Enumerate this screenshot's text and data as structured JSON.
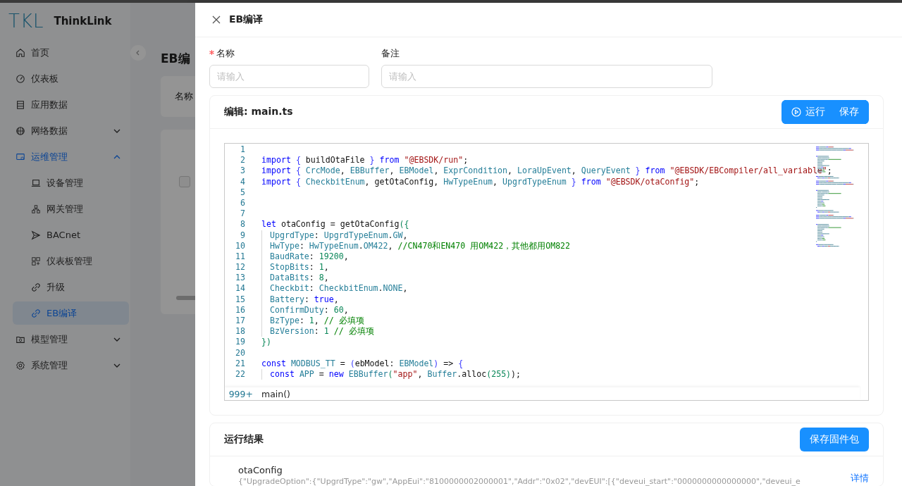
{
  "brand": {
    "logo": "TKL",
    "name": "ThinkLink"
  },
  "sidebar": {
    "items": [
      {
        "label": "首页",
        "selected": false
      },
      {
        "label": "仪表板",
        "selected": false
      },
      {
        "label": "应用数据",
        "selected": false
      },
      {
        "label": "网络数据",
        "selected": false,
        "expanded": false
      },
      {
        "label": "运维管理",
        "selected": false,
        "expanded": true,
        "children": [
          {
            "label": "设备管理",
            "selected": false
          },
          {
            "label": "网关管理",
            "selected": false
          },
          {
            "label": "BACnet",
            "selected": false
          },
          {
            "label": "仪表板管理",
            "selected": false
          },
          {
            "label": "升级",
            "selected": false
          },
          {
            "label": "EB编译",
            "selected": true
          }
        ]
      },
      {
        "label": "模型管理",
        "selected": false,
        "expanded": false
      },
      {
        "label": "系统管理",
        "selected": false,
        "expanded": false
      }
    ]
  },
  "background_page": {
    "title": "EB编",
    "filter_label": "名称",
    "table_checkbox": {
      "checked": false
    }
  },
  "drawer": {
    "title": "EB编译",
    "form": [
      {
        "label": "名称",
        "required": true,
        "placeholder": "请输入"
      },
      {
        "label": "备注",
        "required": false,
        "placeholder": "请输入"
      }
    ],
    "editor": {
      "title": "编辑: main.ts",
      "buttons": [
        {
          "label": "运行",
          "kind": "run"
        },
        {
          "label": "保存",
          "kind": "plain"
        }
      ],
      "lines": [
        {
          "number": "1"
        },
        {
          "number": "2",
          "indented": false,
          "tokens": [
            {
              "kind": "kw",
              "text": "import "
            },
            {
              "kind": "brace",
              "text": "{ "
            },
            {
              "kind": "plain",
              "text": "buildOtaFile "
            },
            {
              "kind": "brace",
              "text": "} "
            },
            {
              "kind": "kw",
              "text": "from "
            },
            {
              "kind": "str",
              "text": "\"@EBSDK/run\""
            },
            {
              "kind": "plain",
              "text": ";"
            }
          ]
        },
        {
          "number": "3",
          "indented": false,
          "tokens": [
            {
              "kind": "kw",
              "text": "import "
            },
            {
              "kind": "brace",
              "text": "{ "
            },
            {
              "kind": "type",
              "text": "CrcMode"
            },
            {
              "kind": "plain",
              "text": ", "
            },
            {
              "kind": "type",
              "text": "EBBuffer"
            },
            {
              "kind": "plain",
              "text": ", "
            },
            {
              "kind": "type",
              "text": "EBModel"
            },
            {
              "kind": "plain",
              "text": ", "
            },
            {
              "kind": "type",
              "text": "ExprCondition"
            },
            {
              "kind": "plain",
              "text": ", "
            },
            {
              "kind": "type",
              "text": "LoraUpEvent"
            },
            {
              "kind": "plain",
              "text": ", "
            },
            {
              "kind": "type",
              "text": "QueryEvent "
            },
            {
              "kind": "brace",
              "text": "} "
            },
            {
              "kind": "kw",
              "text": "from "
            },
            {
              "kind": "str",
              "text": "\"@EBSDK/EBCompiler/all_variable\""
            },
            {
              "kind": "plain",
              "text": ";"
            }
          ]
        },
        {
          "number": "4",
          "indented": false,
          "tokens": [
            {
              "kind": "kw",
              "text": "import "
            },
            {
              "kind": "brace",
              "text": "{ "
            },
            {
              "kind": "type",
              "text": "CheckbitEnum"
            },
            {
              "kind": "plain",
              "text": ", getOtaConfig, "
            },
            {
              "kind": "type",
              "text": "HwTypeEnum"
            },
            {
              "kind": "plain",
              "text": ", "
            },
            {
              "kind": "type",
              "text": "UpgrdTypeEnum "
            },
            {
              "kind": "brace",
              "text": "} "
            },
            {
              "kind": "kw",
              "text": "from "
            },
            {
              "kind": "str",
              "text": "\"@EBSDK/otaConfig\""
            },
            {
              "kind": "plain",
              "text": ";"
            }
          ]
        },
        {
          "number": "5"
        },
        {
          "number": "6"
        },
        {
          "number": "7"
        },
        {
          "number": "8",
          "indented": false,
          "tokens": [
            {
              "kind": "kw",
              "text": "let "
            },
            {
              "kind": "plain",
              "text": "otaConfig = getOtaConfig"
            },
            {
              "kind": "num",
              "text": "({"
            }
          ]
        },
        {
          "number": "9",
          "indented": true,
          "tokens": [
            {
              "kind": "prop",
              "text": "UpgrdType"
            },
            {
              "kind": "plain",
              "text": ": "
            },
            {
              "kind": "type",
              "text": "UpgrdTypeEnum"
            },
            {
              "kind": "plain",
              "text": "."
            },
            {
              "kind": "type",
              "text": "GW"
            },
            {
              "kind": "plain",
              "text": ","
            }
          ]
        },
        {
          "number": "10",
          "indented": true,
          "tokens": [
            {
              "kind": "prop",
              "text": "HwType"
            },
            {
              "kind": "plain",
              "text": ": "
            },
            {
              "kind": "type",
              "text": "HwTypeEnum"
            },
            {
              "kind": "plain",
              "text": "."
            },
            {
              "kind": "type",
              "text": "OM422"
            },
            {
              "kind": "plain",
              "text": ", "
            },
            {
              "kind": "com",
              "text": "//CN470和EN470 用OM422，其他都用OM822"
            }
          ]
        },
        {
          "number": "11",
          "indented": true,
          "tokens": [
            {
              "kind": "prop",
              "text": "BaudRate"
            },
            {
              "kind": "plain",
              "text": ": "
            },
            {
              "kind": "num",
              "text": "19200"
            },
            {
              "kind": "plain",
              "text": ","
            }
          ]
        },
        {
          "number": "12",
          "indented": true,
          "tokens": [
            {
              "kind": "prop",
              "text": "StopBits"
            },
            {
              "kind": "plain",
              "text": ": "
            },
            {
              "kind": "num",
              "text": "1"
            },
            {
              "kind": "plain",
              "text": ","
            }
          ]
        },
        {
          "number": "13",
          "indented": true,
          "tokens": [
            {
              "kind": "prop",
              "text": "DataBits"
            },
            {
              "kind": "plain",
              "text": ": "
            },
            {
              "kind": "num",
              "text": "8"
            },
            {
              "kind": "plain",
              "text": ","
            }
          ]
        },
        {
          "number": "14",
          "indented": true,
          "tokens": [
            {
              "kind": "prop",
              "text": "Checkbit"
            },
            {
              "kind": "plain",
              "text": ": "
            },
            {
              "kind": "type",
              "text": "CheckbitEnum"
            },
            {
              "kind": "plain",
              "text": "."
            },
            {
              "kind": "type",
              "text": "NONE"
            },
            {
              "kind": "plain",
              "text": ","
            }
          ]
        },
        {
          "number": "15",
          "indented": true,
          "tokens": [
            {
              "kind": "prop",
              "text": "Battery"
            },
            {
              "kind": "plain",
              "text": ": "
            },
            {
              "kind": "kw",
              "text": "true"
            },
            {
              "kind": "plain",
              "text": ","
            }
          ]
        },
        {
          "number": "16",
          "indented": true,
          "tokens": [
            {
              "kind": "prop",
              "text": "ConfirmDuty"
            },
            {
              "kind": "plain",
              "text": ": "
            },
            {
              "kind": "num",
              "text": "60"
            },
            {
              "kind": "plain",
              "text": ","
            }
          ]
        },
        {
          "number": "17",
          "indented": true,
          "tokens": [
            {
              "kind": "prop",
              "text": "BzType"
            },
            {
              "kind": "plain",
              "text": ": "
            },
            {
              "kind": "num",
              "text": "1"
            },
            {
              "kind": "plain",
              "text": ", "
            },
            {
              "kind": "com",
              "text": "// 必填项"
            }
          ]
        },
        {
          "number": "18",
          "indented": true,
          "tokens": [
            {
              "kind": "prop",
              "text": "BzVersion"
            },
            {
              "kind": "plain",
              "text": ": "
            },
            {
              "kind": "num",
              "text": "1 "
            },
            {
              "kind": "com",
              "text": "// 必填项"
            }
          ]
        },
        {
          "number": "19",
          "indented": false,
          "tokens": [
            {
              "kind": "num",
              "text": "})"
            }
          ]
        },
        {
          "number": "20"
        },
        {
          "number": "21",
          "indented": false,
          "tokens": [
            {
              "kind": "kw",
              "text": "const "
            },
            {
              "kind": "type",
              "text": "MODBUS_TT"
            },
            {
              "kind": "plain",
              "text": " = "
            },
            {
              "kind": "brace",
              "text": "("
            },
            {
              "kind": "plain",
              "text": "ebModel: "
            },
            {
              "kind": "type",
              "text": "EBModel"
            },
            {
              "kind": "brace",
              "text": ") "
            },
            {
              "kind": "plain",
              "text": "=> "
            },
            {
              "kind": "brace",
              "text": "{"
            }
          ]
        },
        {
          "number": "22",
          "indented": true,
          "tokens": [
            {
              "kind": "kw",
              "text": "const "
            },
            {
              "kind": "type",
              "text": "APP"
            },
            {
              "kind": "plain",
              "text": " = "
            },
            {
              "kind": "kw",
              "text": "new "
            },
            {
              "kind": "type",
              "text": "EBBuffer"
            },
            {
              "kind": "num",
              "text": "("
            },
            {
              "kind": "str",
              "text": "\"app\""
            },
            {
              "kind": "plain",
              "text": ", "
            },
            {
              "kind": "type",
              "text": "Buffer"
            },
            {
              "kind": "plain",
              "text": ".alloc"
            },
            {
              "kind": "num",
              "text": "(255)"
            },
            {
              "kind": "plain",
              "text": ");"
            }
          ]
        }
      ],
      "sticky_line": {
        "number": "999+",
        "text": "main()"
      }
    },
    "result": {
      "title": "运行结果",
      "button": "保存固件包",
      "items": [
        {
          "name": "otaConfig",
          "value": "{\"UpgradeOption\":{\"UpgrdType\":\"gw\",\"AppEui\":\"8100000002000001\",\"Addr\":\"0x02\",\"devEUI\":[{\"deveui_start\":\"0000000000000000\",\"deveui_e",
          "link": "详情"
        }
      ]
    }
  }
}
